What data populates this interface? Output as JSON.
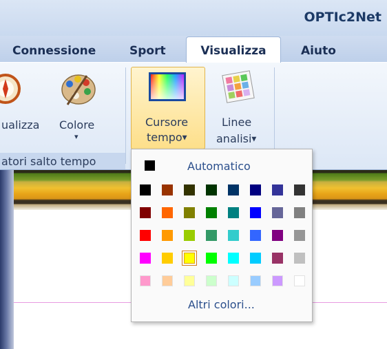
{
  "app": {
    "title": "OPTIc2Net"
  },
  "tabs": [
    {
      "label": "Connessione"
    },
    {
      "label": "Sport"
    },
    {
      "label": "Visualizza",
      "active": true
    },
    {
      "label": "Aiuto"
    }
  ],
  "ribbon": {
    "btn_visualizza": "ualizza",
    "btn_colore": "Colore",
    "btn_colore_arrow": "▾",
    "btn_cursore_line1": "Cursore",
    "btn_cursore_line2": "tempo",
    "btn_linee_line1": "Linee",
    "btn_linee_line2": "analisi",
    "group_label": "atori salto tempo"
  },
  "color_menu": {
    "automatic_label": "Automatico",
    "more_colors_label": "Altri colori...",
    "selected": "#ffff00",
    "rows": [
      [
        "#000000",
        "#993300",
        "#333300",
        "#003300",
        "#003366",
        "#000080",
        "#333399",
        "#333333"
      ],
      [
        "#800000",
        "#ff6600",
        "#808000",
        "#008000",
        "#008080",
        "#0000ff",
        "#666699",
        "#808080"
      ],
      [
        "#ff0000",
        "#ff9900",
        "#99cc00",
        "#339966",
        "#33cccc",
        "#3366ff",
        "#800080",
        "#969696"
      ],
      [
        "#ff00ff",
        "#ffcc00",
        "#ffff00",
        "#00ff00",
        "#00ffff",
        "#00ccff",
        "#993366",
        "#c0c0c0"
      ],
      [
        "#ff99cc",
        "#ffcc99",
        "#ffff99",
        "#ccffcc",
        "#ccffff",
        "#99ccff",
        "#cc99ff",
        "#ffffff"
      ]
    ]
  }
}
